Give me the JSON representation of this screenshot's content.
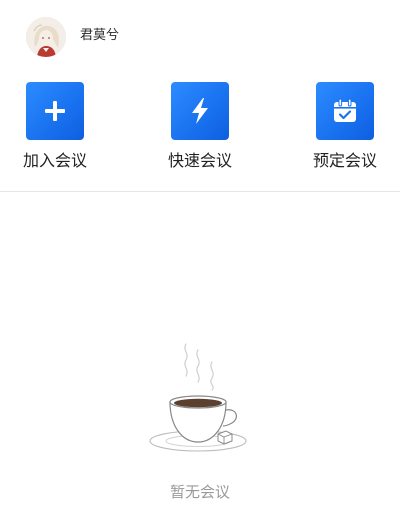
{
  "user": {
    "name": "君莫兮"
  },
  "actions": [
    {
      "label": "加入会议",
      "icon": "plus-icon"
    },
    {
      "label": "快速会议",
      "icon": "lightning-icon"
    },
    {
      "label": "预定会议",
      "icon": "calendar-check-icon"
    }
  ],
  "empty_state": {
    "text": "暂无会议",
    "icon": "coffee-cup-icon"
  },
  "colors": {
    "accent": "#1a73f0",
    "divider": "#e6e6e6",
    "muted_text": "#9a9a9a"
  }
}
